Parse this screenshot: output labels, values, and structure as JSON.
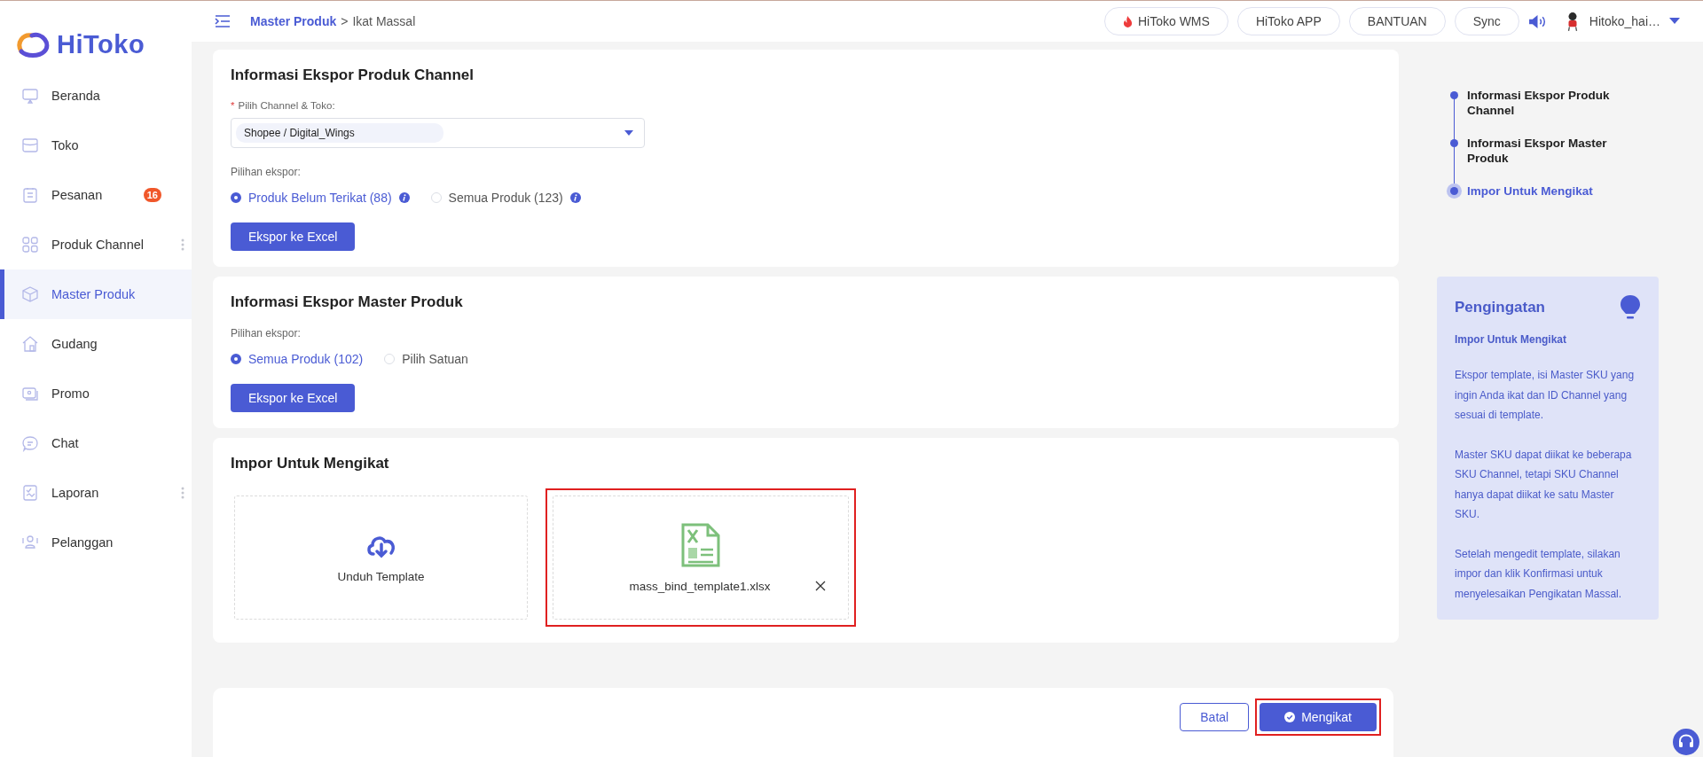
{
  "brand": {
    "name": "HiToko"
  },
  "sidebar": {
    "items": [
      {
        "label": "Beranda",
        "selected": false,
        "has_submenu": false
      },
      {
        "label": "Toko",
        "selected": false,
        "has_submenu": false
      },
      {
        "label": "Pesanan",
        "selected": false,
        "has_submenu": false,
        "badge": "16"
      },
      {
        "label": "Produk Channel",
        "selected": false,
        "has_submenu": true
      },
      {
        "label": "Master Produk",
        "selected": true,
        "has_submenu": false
      },
      {
        "label": "Gudang",
        "selected": false,
        "has_submenu": false
      },
      {
        "label": "Promo",
        "selected": false,
        "has_submenu": false
      },
      {
        "label": "Chat",
        "selected": false,
        "has_submenu": false
      },
      {
        "label": "Laporan",
        "selected": false,
        "has_submenu": true
      },
      {
        "label": "Pelanggan",
        "selected": false,
        "has_submenu": false
      }
    ]
  },
  "header": {
    "breadcrumb": {
      "parent": "Master Produk",
      "separator": ">",
      "current": "Ikat Massal"
    },
    "buttons": [
      {
        "label": "HiToko WMS",
        "kind": "hot"
      },
      {
        "label": "HiToko APP",
        "kind": "plain"
      },
      {
        "label": "BANTUAN",
        "kind": "plain"
      },
      {
        "label": "Sync",
        "kind": "plain"
      }
    ],
    "user": {
      "name": "Hitoko_hai…"
    }
  },
  "sections": [
    {
      "kind": "export",
      "title": "Informasi Ekspor Produk Channel",
      "field": {
        "required_mark": "*",
        "label": "Pilih Channel & Toko:",
        "value": "Shopee / Digital_Wings"
      },
      "options_label": "Pilihan ekspor:",
      "options": [
        {
          "label": "Produk Belum Terikat (88)",
          "selected": true,
          "info": true
        },
        {
          "label": "Semua Produk (123)",
          "selected": false,
          "info": true
        }
      ],
      "button": "Ekspor ke Excel"
    },
    {
      "kind": "export",
      "title": "Informasi Ekspor Master Produk",
      "options_label": "Pilihan ekspor:",
      "options": [
        {
          "label": "Semua Produk (102)",
          "selected": true,
          "info": false
        },
        {
          "label": "Pilih Satuan",
          "selected": false,
          "info": false
        }
      ],
      "button": "Ekspor ke Excel"
    },
    {
      "kind": "import",
      "title": "Impor Untuk Mengikat",
      "tiles": [
        {
          "kind": "download",
          "label": "Unduh Template",
          "highlighted": false
        },
        {
          "kind": "file",
          "label": "mass_bind_template1.xlsx",
          "highlighted": true
        }
      ]
    }
  ],
  "footer": {
    "buttons": [
      {
        "label": "Batal",
        "kind": "outline",
        "highlighted": false
      },
      {
        "label": "Mengikat",
        "kind": "primary",
        "highlighted": true
      }
    ]
  },
  "steps": [
    {
      "label": "Informasi Ekspor Produk Channel",
      "active": false
    },
    {
      "label": "Informasi Ekspor Master Produk",
      "active": false
    },
    {
      "label": "Impor Untuk Mengikat",
      "active": true
    }
  ],
  "reminder": {
    "title": "Pengingatan",
    "subtitle": "Impor Untuk Mengikat",
    "paragraphs": [
      "Ekspor template, isi Master SKU yang ingin Anda ikat dan ID Channel yang sesuai di template.",
      "Master SKU dapat diikat ke beberapa SKU Channel, tetapi SKU Channel hanya dapat diikat ke satu Master SKU.",
      "Setelah mengedit template, silakan impor dan klik Konfirmasi untuk menyelesaikan Pengikatan Massal."
    ]
  }
}
